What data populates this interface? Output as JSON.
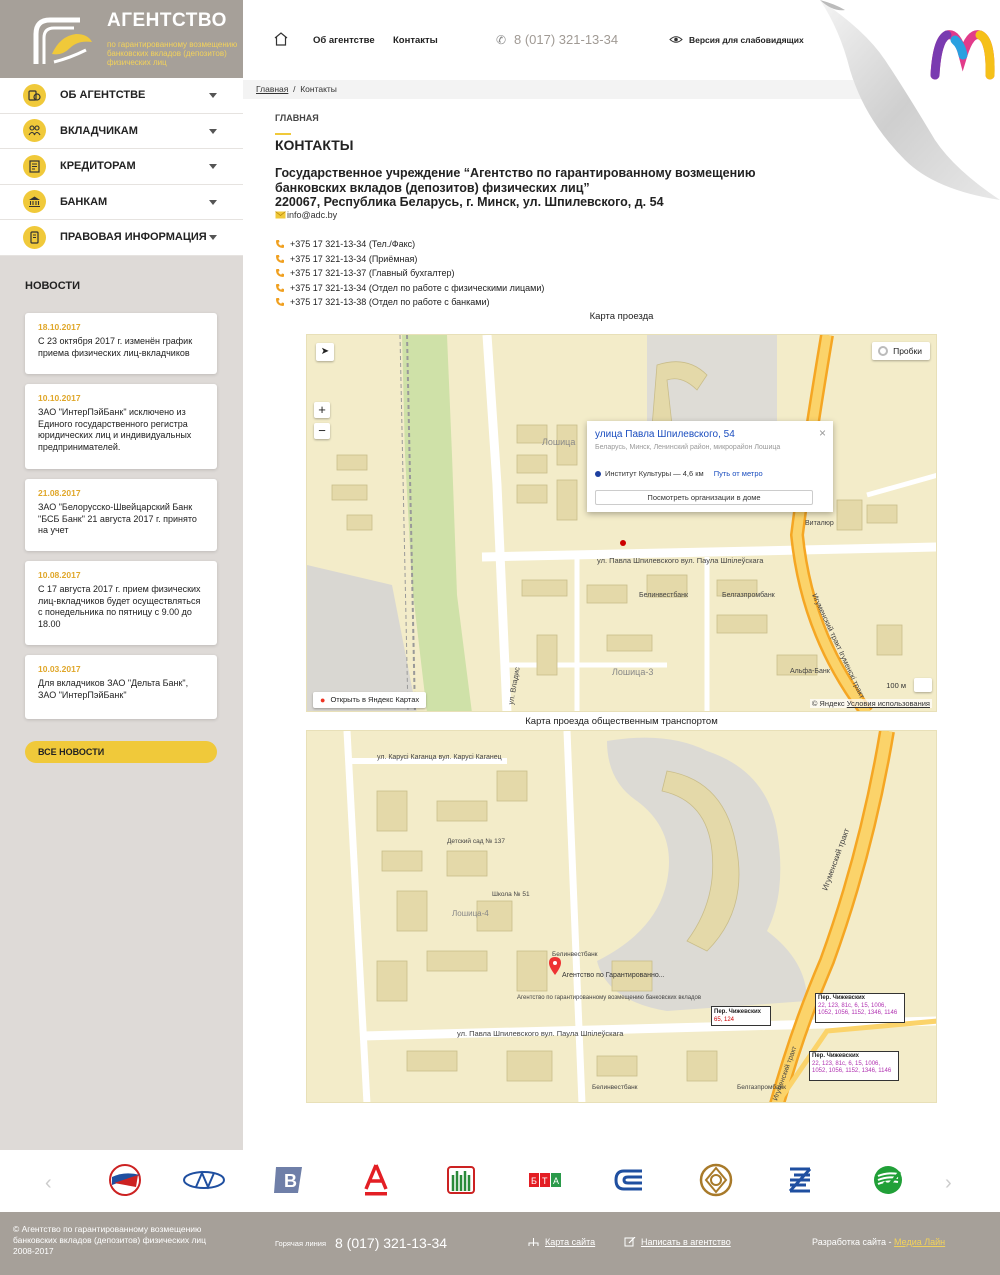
{
  "brand": {
    "title": "АГЕНТСТВО",
    "subtitle": "по гарантированному возмещению банковских вкладов (депозитов) физических лиц"
  },
  "menu": [
    {
      "label": "ОБ АГЕНТСТВЕ",
      "icon": "coins-icon"
    },
    {
      "label": "ВКЛАДЧИКАМ",
      "icon": "people-icon"
    },
    {
      "label": "КРЕДИТОРАМ",
      "icon": "document-icon"
    },
    {
      "label": "БАНКАМ",
      "icon": "bank-icon"
    },
    {
      "label": "ПРАВОВАЯ ИНФОРМАЦИЯ",
      "icon": "law-icon"
    }
  ],
  "news": {
    "title": "НОВОСТИ",
    "items": [
      {
        "date": "18.10.2017",
        "text": "С 23 октября 2017 г. изменён график приема физических лиц-вкладчиков"
      },
      {
        "date": "10.10.2017",
        "text": "ЗАО \"ИнтерПэйБанк\" исключено из Единого государственного регистра юридических лиц и индивидуальных предпринимателей."
      },
      {
        "date": "21.08.2017",
        "text": "ЗАО \"Белорусско-Швейцарский Банк \"БСБ Банк\" 21 августа 2017 г. принято на учет"
      },
      {
        "date": "10.08.2017",
        "text": "С 17 августа 2017 г. прием физических лиц-вкладчиков будет осуществляться с понедельника по пятницу с 9.00 до 18.00"
      },
      {
        "date": "10.03.2017",
        "text": "Для вкладчиков ЗАО \"Дельта Банк\", ЗАО \"ИнтерПэйБанк\""
      }
    ],
    "all_label": "ВСЕ НОВОСТИ"
  },
  "topbar": {
    "about": "Об агентстве",
    "contacts": "Контакты",
    "phone": "8 (017) 321-13-34",
    "vision": "Версия для слабовидящих"
  },
  "breadcrumbs": {
    "home": "Главная",
    "separator": "/",
    "current": "Контакты"
  },
  "content": {
    "section": "ГЛАВНАЯ",
    "title": "КОНТАКТЫ",
    "org": "Государственное учреждение “Агентство по гарантированному возмещению банковских вкладов (депозитов) физических лиц”",
    "address": "220067, Республика Беларусь, г. Минск, ул. Шпилевского, д. 54",
    "email": "info@adc.by",
    "phones": [
      "+375 17 321-13-34 (Тел./Факс)",
      "+375 17 321-13-34 (Приёмная)",
      "+375 17 321-13-37 (Главный бухгалтер)",
      "+375 17 321-13-34 (Отдел по работе с физическими лицами)",
      "+375 17 321-13-38 (Отдел по работе с банками)"
    ]
  },
  "map1": {
    "caption": "Карта проезда",
    "traffic": "Пробки",
    "popup_title": "улица Павла Шпилевского, 54",
    "popup_sub": "Беларусь, Минск, Ленинский район, микрорайон Лошица",
    "metro": "Институт Культуры — 4,6 км",
    "metro_link": "Путь от метро",
    "orgs_button": "Посмотреть организации в доме",
    "open_yandex": "Открыть в Яндекс Картах",
    "scale": "100 м",
    "copyright": "© Яндекс",
    "terms": "Условия использования",
    "labels": {
      "street1": "ул. Павла Шпилевского вул. Паула Шпілеўскага",
      "district1": "Лошица",
      "district3": "Лошица-3",
      "tract": "Игуменский тракт  Ігуменскі тракт",
      "bank1": "Белинвестбанк",
      "bank2": "Белгазпромбанк",
      "bank3": "Альфа-Банк",
      "shop": "Виталюр",
      "street2": "ул. Владис"
    }
  },
  "map2": {
    "caption": "Карта проезда общественным транспортом",
    "labels": {
      "street_top": "ул. Карусі Каганца вул. Карусі Каганец",
      "street_bottom": "ул. Павла Шпилевского вул. Паула Шпілеўскага",
      "district": "Лошица-4",
      "school": "Школа № 51",
      "garden": "Детский сад № 137",
      "agency_pin": "Агентство по Гарантированно...",
      "agency_label": "Агентство по гарантированному возмещению банковских вкладов",
      "bank": "Белинвестбанк",
      "bank2": "Белгазпромбанк",
      "tract": "Игуменский тракт",
      "stop1_title": "Пер. Чижевских",
      "stop1_routes": "65, 124",
      "stop2_title": "Пер. Чижевских",
      "stop2_routes": "22, 123, 81с, 6, 15, 1006, 1052, 1056, 1152, 1346, 1146",
      "stop3_title": "Пер. Чижевских",
      "stop3_routes": "22, 123, 81с, 6, 15, 1006, 1052, 1056, 1152, 1346, 1146"
    }
  },
  "footer": {
    "copyright": "©  Агентство по гарантированному возмещению банковских вкладов (депозитов) физических лиц 2008-2017",
    "hotline_label": "Горячая линия",
    "hotline_phone": "8 (017) 321-13-34",
    "sitemap": "Карта сайта",
    "write": "Написать в агентство",
    "dev_label": "Разработка сайта -",
    "dev_name": "Медиа Лайн"
  },
  "bank_logos": [
    "priorbank-logo",
    "belvnesheconombank-logo",
    "bps-logo",
    "alfa-bank-logo",
    "belarusbank-logo",
    "bta-logo",
    "belinvestbank-logo",
    "belagroprombank-logo",
    "zepter-logo",
    "bps-sberbank-logo"
  ]
}
